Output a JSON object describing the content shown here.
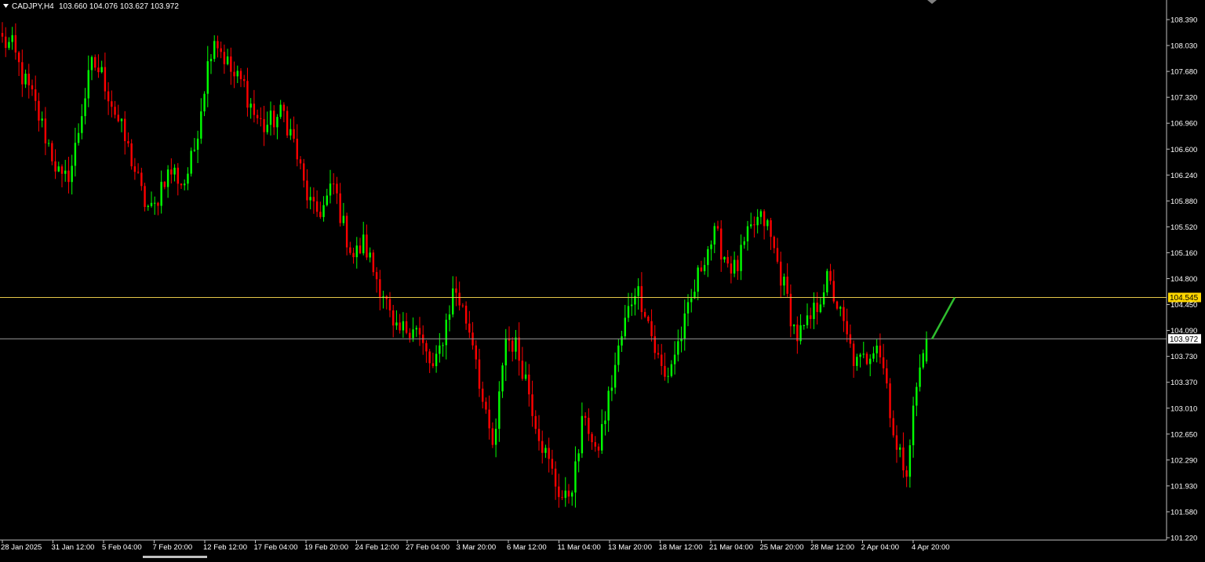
{
  "header": {
    "symbol_timeframe": "CADJPY,H4",
    "ohlc": "103.660 104.076 103.627 103.972"
  },
  "colors": {
    "background": "#000000",
    "bull": "#00ff00",
    "bear": "#ff0000",
    "axis": "#c0c0c0",
    "text": "#ffffff",
    "hline_resistance": "#e6c84a",
    "hline_bid": "#9a9a9a",
    "trend_arrow": "#2ebd2e",
    "level_label_bg": "#ffd700"
  },
  "chart_data": {
    "type": "candlestick",
    "symbol": "CADJPY",
    "timeframe": "H4",
    "ylim": [
      101.22,
      108.57
    ],
    "y_ticks": [
      "108.390",
      "108.030",
      "107.680",
      "107.320",
      "106.960",
      "106.600",
      "106.240",
      "105.880",
      "105.520",
      "105.160",
      "104.800",
      "104.450",
      "104.090",
      "103.730",
      "103.370",
      "103.010",
      "102.650",
      "102.290",
      "101.930",
      "101.580",
      "101.220"
    ],
    "x_ticks": [
      "28 Jan 2025",
      "31 Jan 12:00",
      "5 Feb 04:00",
      "7 Feb 20:00",
      "12 Feb 12:00",
      "17 Feb 04:00",
      "19 Feb 20:00",
      "24 Feb 12:00",
      "27 Feb 04:00",
      "3 Mar 20:00",
      "6 Mar 12:00",
      "11 Mar 04:00",
      "13 Mar 20:00",
      "18 Mar 12:00",
      "21 Mar 04:00",
      "25 Mar 20:00",
      "28 Mar 12:00",
      "2 Apr 04:00",
      "4 Apr 20:00"
    ],
    "horizontal_levels": [
      {
        "price": 104.545,
        "label": "104.545",
        "style": "resistance"
      },
      {
        "price": 103.972,
        "label": "103.972",
        "style": "bid"
      }
    ],
    "projection": {
      "from": [
        103.97
      ],
      "to": [
        104.545
      ]
    },
    "anchors": [
      108.1,
      108.0,
      107.6,
      107.3,
      106.9,
      106.5,
      106.1,
      106.4,
      107.2,
      107.8,
      107.6,
      107.2,
      106.8,
      106.4,
      105.9,
      105.7,
      106.2,
      106.3,
      106.1,
      106.5,
      107.4,
      108.2,
      107.9,
      107.6,
      107.5,
      107.1,
      106.9,
      107.0,
      107.1,
      106.7,
      106.1,
      105.7,
      105.8,
      106.1,
      105.5,
      105.1,
      105.3,
      104.9,
      104.6,
      104.0,
      104.1,
      104.2,
      103.8,
      103.5,
      104.1,
      104.7,
      104.3,
      103.9,
      102.9,
      102.4,
      104.0,
      103.9,
      103.5,
      102.9,
      102.4,
      102.0,
      101.7,
      102.1,
      103.0,
      102.3,
      102.9,
      103.6,
      104.2,
      104.7,
      104.4,
      103.8,
      103.4,
      103.8,
      104.2,
      104.7,
      105.2,
      105.4,
      105.1,
      104.9,
      105.3,
      105.6,
      105.6,
      105.1,
      104.6,
      104.0,
      104.1,
      104.4,
      104.8,
      104.5,
      104.0,
      103.6,
      103.7,
      104.0,
      103.4,
      102.4,
      102.2,
      103.3,
      103.97
    ],
    "candle_count": 280,
    "last": {
      "open": 103.66,
      "high": 104.076,
      "low": 103.627,
      "close": 103.972
    }
  }
}
